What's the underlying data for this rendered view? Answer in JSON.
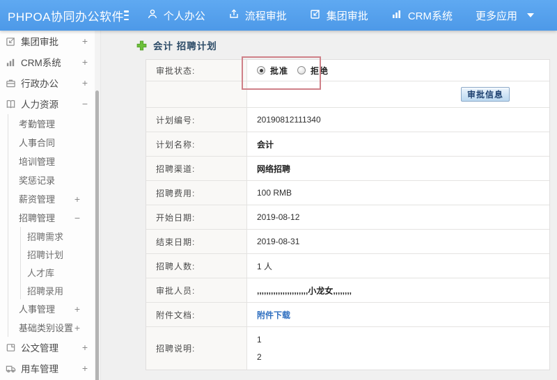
{
  "header": {
    "logo": "PHPOA协同办公软件",
    "nav": [
      {
        "label": "个人办公",
        "icon": "person-icon"
      },
      {
        "label": "流程审批",
        "icon": "flow-icon"
      },
      {
        "label": "集团审批",
        "icon": "edit-icon"
      },
      {
        "label": "CRM系统",
        "icon": "chart-icon"
      },
      {
        "label": "更多应用",
        "icon": "caret-down-icon"
      }
    ]
  },
  "sidebar": {
    "items": [
      {
        "label": "集团审批",
        "icon": "edit-icon",
        "toggle": "+"
      },
      {
        "label": "CRM系统",
        "icon": "chart-icon",
        "toggle": "+"
      },
      {
        "label": "行政办公",
        "icon": "briefcase-icon",
        "toggle": "+"
      },
      {
        "label": "人力资源",
        "icon": "book-icon",
        "toggle": "−"
      },
      {
        "label": "考勤管理"
      },
      {
        "label": "人事合同"
      },
      {
        "label": "培训管理"
      },
      {
        "label": "奖惩记录"
      },
      {
        "label": "薪资管理",
        "toggle": "+"
      },
      {
        "label": "招聘管理",
        "toggle": "−"
      },
      {
        "label": "招聘需求"
      },
      {
        "label": "招聘计划"
      },
      {
        "label": "人才库"
      },
      {
        "label": "招聘录用"
      },
      {
        "label": "人事管理",
        "toggle": "+"
      },
      {
        "label": "基础类别设置",
        "toggle": "+"
      },
      {
        "label": "公文管理",
        "icon": "doc-icon",
        "toggle": "+"
      },
      {
        "label": "用车管理",
        "icon": "truck-icon",
        "toggle": "+"
      }
    ]
  },
  "main": {
    "title": "会计 招聘计划",
    "approval": {
      "label": "审批状态:",
      "options": [
        {
          "label": "批准",
          "selected": true
        },
        {
          "label": "拒绝",
          "selected": false
        }
      ]
    },
    "approve_button": "审批信息",
    "rows": [
      {
        "label": "计划编号:",
        "value": "20190812111340"
      },
      {
        "label": "计划名称:",
        "value": "会计"
      },
      {
        "label": "招聘渠道:",
        "value": "网络招聘"
      },
      {
        "label": "招聘费用:",
        "value": "100 RMB"
      },
      {
        "label": "开始日期:",
        "value": "2019-08-12"
      },
      {
        "label": "结束日期:",
        "value": "2019-08-31"
      },
      {
        "label": "招聘人数:",
        "value": "1 人"
      },
      {
        "label": "审批人员:",
        "value": ",,,,,,,,,,,,,,,,,,,,,,小龙女,,,,,,,,"
      },
      {
        "label": "附件文档:",
        "value": "附件下载"
      },
      {
        "label": "招聘说明:",
        "lines": [
          "1",
          "2"
        ]
      }
    ],
    "colors": {
      "header_blue": "#4d99e8",
      "annotation_red": "#cf8088",
      "link_blue": "#2f6fc0",
      "plus_green": "#6dc13a"
    }
  }
}
